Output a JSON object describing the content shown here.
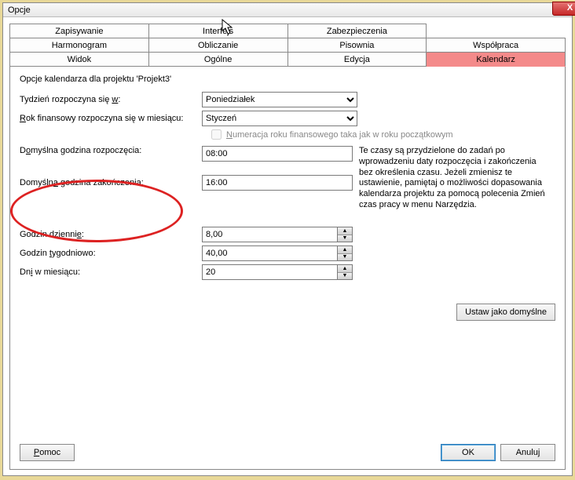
{
  "window": {
    "title": "Opcje",
    "close": "X"
  },
  "tabs": {
    "row1": [
      "Zapisywanie",
      "Interfejs",
      "Zabezpieczenia",
      ""
    ],
    "row2": [
      "Harmonogram",
      "Obliczanie",
      "Pisownia",
      "Współpraca"
    ],
    "row3": [
      "Widok",
      "Ogólne",
      "Edycja",
      "Kalendarz"
    ]
  },
  "section_title": "Opcje kalendarza dla projektu 'Projekt3'",
  "labels": {
    "week_start_pre": "Tydzień rozpoczyna się ",
    "week_start_u": "w",
    "week_start_post": ":",
    "fy_start_pre_u": "R",
    "fy_start_post": "ok finansowy rozpoczyna się w miesiącu:",
    "fy_number_u": "N",
    "fy_number_post": "umeracja roku finansowego taka jak w roku początkowym",
    "default_start_pre": "D",
    "default_start_u": "o",
    "default_start_post": "myślna godzina rozpoczęcia:",
    "default_end_pre": "Domyśln",
    "default_end_u": "a",
    "default_end_post": " godzina zakończenia:",
    "hours_day_pre": "Godzin dzienni",
    "hours_day_u": "e",
    "hours_day_post": ":",
    "hours_week_pre": "Godzin ",
    "hours_week_u": "t",
    "hours_week_post": "ygodniowo:",
    "days_month_pre": "Dn",
    "days_month_u": "i",
    "days_month_post": " w miesiącu:"
  },
  "values": {
    "week_start": "Poniedziałek",
    "fy_start": "Styczeń",
    "default_start": "08:00",
    "default_end": "16:00",
    "hours_day": "8,00",
    "hours_week": "40,00",
    "days_month": "20"
  },
  "info_text": "Te czasy są przydzielone do zadań po wprowadzeniu daty rozpoczęcia i zakończenia bez określenia czasu. Jeżeli zmienisz te ustawienie, pamiętaj o możliwości dopasowania kalendarza projektu za pomocą polecenia Zmień czas pracy w menu Narzędzia.",
  "buttons": {
    "set_default": "Ustaw jako domyślne",
    "help": "Pomoc",
    "ok": "OK",
    "cancel": "Anuluj"
  }
}
